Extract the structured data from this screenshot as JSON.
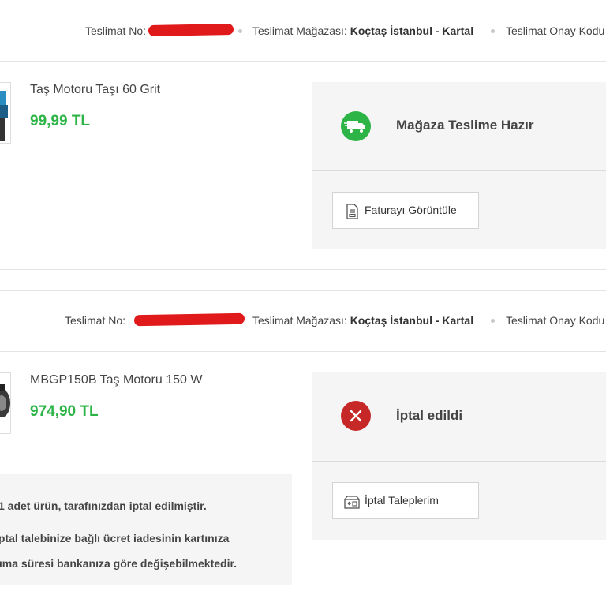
{
  "orders": [
    {
      "header": {
        "delivery_no_label": "Teslimat No:",
        "store_label": "Teslimat Mağazası:",
        "store_name": "Koçtaş İstanbul - Kartal",
        "approval_label": "Teslimat Onay Kodu"
      },
      "product": {
        "name": "Taş Motoru Taşı 60 Grit",
        "price": "99,99 TL"
      },
      "status": {
        "label": "Mağaza Teslime Hazır",
        "icon": "delivery-truck-icon",
        "color": "#2db446"
      },
      "button": {
        "label": "Faturayı Görüntüle",
        "icon": "invoice-icon"
      }
    },
    {
      "header": {
        "delivery_no_label": "Teslimat No:",
        "store_label": "Teslimat Mağazası:",
        "store_name": "Koçtaş İstanbul - Kartal",
        "approval_label": "Teslimat Onay Kodu"
      },
      "product": {
        "name": "MBGP150B Taş Motoru 150 W",
        "price": "974,90 TL"
      },
      "status": {
        "label": "İptal edildi",
        "icon": "cancel-x-icon",
        "color": "#c62828"
      },
      "button": {
        "label": "İptal Taleplerim",
        "icon": "return-box-icon"
      },
      "info": {
        "line1": "1 adet ürün, tarafınızdan iptal edilmiştir.",
        "line2": "İptal talebinize bağlı ücret iadesinin kartınıza",
        "line3": "yansıma süresi bankanıza göre değişebilmektedir."
      }
    }
  ]
}
